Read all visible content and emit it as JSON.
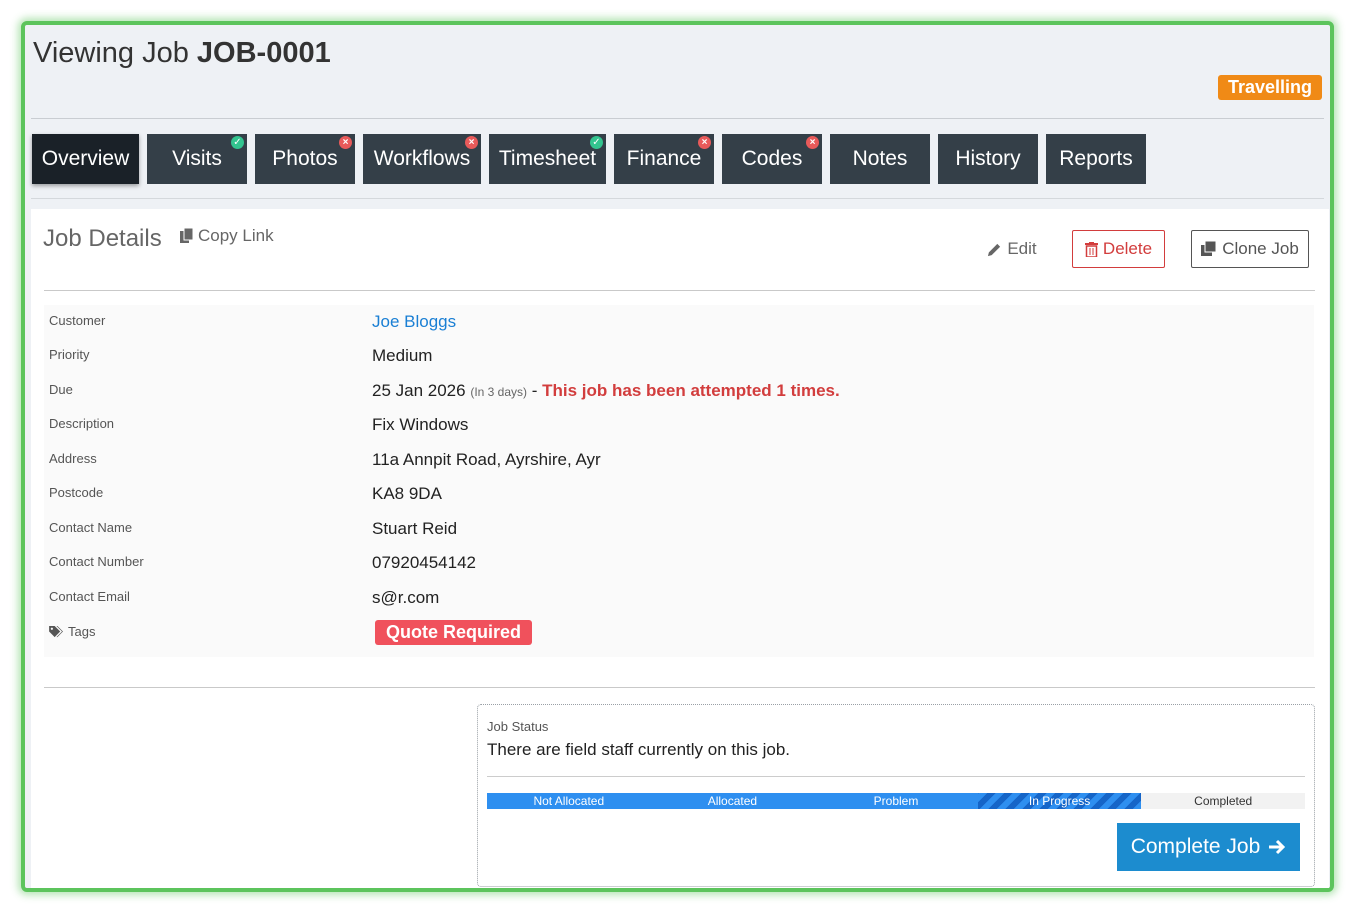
{
  "header": {
    "title_prefix": "Viewing Job",
    "job_id": "JOB-0001",
    "status": "Travelling",
    "status_color": "#f08a16"
  },
  "tabs": [
    {
      "label": "Overview",
      "active": true,
      "indicator": null,
      "width": 107
    },
    {
      "label": "Visits",
      "indicator": "ok",
      "width": 100
    },
    {
      "label": "Photos",
      "indicator": "error",
      "width": 100
    },
    {
      "label": "Workflows",
      "indicator": "error",
      "width": 118
    },
    {
      "label": "Timesheet",
      "indicator": "ok",
      "width": 117
    },
    {
      "label": "Finance",
      "indicator": "error",
      "width": 100
    },
    {
      "label": "Codes",
      "indicator": "error",
      "width": 100
    },
    {
      "label": "Notes",
      "indicator": null,
      "width": 100
    },
    {
      "label": "History",
      "indicator": null,
      "width": 100
    },
    {
      "label": "Reports",
      "indicator": null,
      "width": 100
    }
  ],
  "section": {
    "title": "Job Details",
    "copy_link": "Copy Link",
    "edit": "Edit",
    "delete": "Delete",
    "clone": "Clone Job"
  },
  "details": {
    "customer_label": "Customer",
    "customer": "Joe Bloggs",
    "priority_label": "Priority",
    "priority": "Medium",
    "due_label": "Due",
    "due_date": "25 Jan 2026",
    "due_relative": "(In 3 days)",
    "due_separator": " - ",
    "due_warning": "This job has been attempted 1 times.",
    "description_label": "Description",
    "description": "Fix Windows",
    "address_label": "Address",
    "address": "11a Annpit Road, Ayrshire, Ayr",
    "postcode_label": "Postcode",
    "postcode": "KA8 9DA",
    "contact_name_label": "Contact Name",
    "contact_name": "Stuart Reid",
    "contact_number_label": "Contact Number",
    "contact_number": "07920454142",
    "contact_email_label": "Contact Email",
    "contact_email": "s@r.com",
    "tags_label": "Tags",
    "tag": "Quote Required"
  },
  "job_status": {
    "label": "Job Status",
    "message": "There are field staff currently on this job.",
    "steps": [
      "Not Allocated",
      "Allocated",
      "Problem",
      "In Progress",
      "Completed"
    ],
    "complete_button": "Complete Job"
  }
}
